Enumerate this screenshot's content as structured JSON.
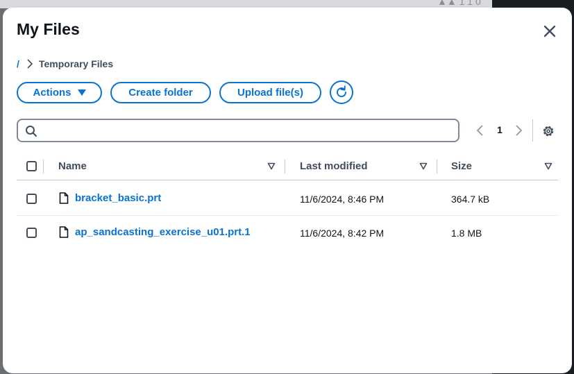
{
  "background": {
    "top_glyph": "▲▲ 1 1 0"
  },
  "dialog": {
    "title": "My Files",
    "breadcrumb": {
      "root": "/",
      "current": "Temporary Files"
    },
    "toolbar": {
      "actions_label": "Actions",
      "create_folder_label": "Create folder",
      "upload_label": "Upload file(s)"
    },
    "search": {
      "value": "",
      "placeholder": ""
    },
    "pagination": {
      "current_page": "1"
    },
    "table": {
      "columns": {
        "name": "Name",
        "modified": "Last modified",
        "size": "Size"
      },
      "rows": [
        {
          "name": "bracket_basic.prt",
          "modified": "11/6/2024, 8:46 PM",
          "size": "364.7 kB"
        },
        {
          "name": "ap_sandcasting_exercise_u01.prt.1",
          "modified": "11/6/2024, 8:42 PM",
          "size": "1.8 MB"
        }
      ]
    }
  },
  "colors": {
    "accent": "#0972d3",
    "text": "#0f141a",
    "muted": "#414d5c",
    "border": "#7d8998",
    "overlay": "#6b6e72"
  }
}
